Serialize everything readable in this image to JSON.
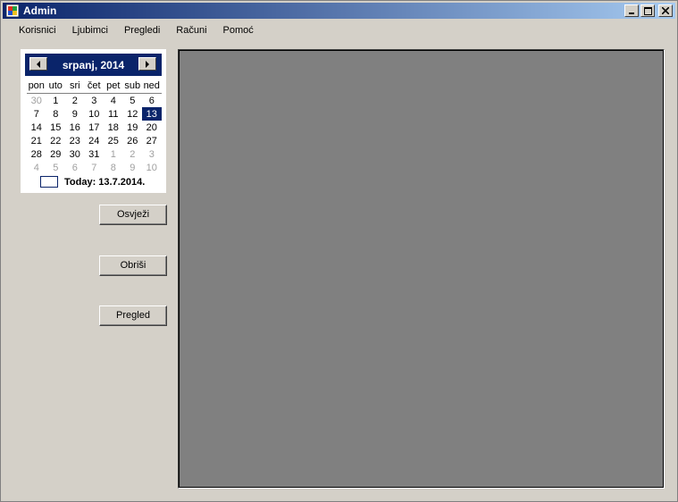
{
  "window": {
    "title": "Admin",
    "controls": {
      "minimize": "minimize-icon",
      "maximize": "maximize-icon",
      "close": "close-icon"
    }
  },
  "menu": {
    "items": [
      "Korisnici",
      "Ljubimci",
      "Pregledi",
      "Računi",
      "Pomoć"
    ]
  },
  "calendar": {
    "month_label": "srpanj, 2014",
    "day_names": [
      "pon",
      "uto",
      "sri",
      "čet",
      "pet",
      "sub",
      "ned"
    ],
    "weeks": [
      [
        "30",
        "1",
        "2",
        "3",
        "4",
        "5",
        "6"
      ],
      [
        "7",
        "8",
        "9",
        "10",
        "11",
        "12",
        "13"
      ],
      [
        "14",
        "15",
        "16",
        "17",
        "18",
        "19",
        "20"
      ],
      [
        "21",
        "22",
        "23",
        "24",
        "25",
        "26",
        "27"
      ],
      [
        "28",
        "29",
        "30",
        "31",
        "1",
        "2",
        "3"
      ],
      [
        "4",
        "5",
        "6",
        "7",
        "8",
        "9",
        "10"
      ]
    ],
    "selected_day": "13",
    "today_label": "Today: 13.7.2014."
  },
  "buttons": {
    "refresh": "Osvježi",
    "delete": "Obriši",
    "view": "Pregled"
  },
  "colors": {
    "window_bg": "#d4d0c8",
    "title_gradient_start": "#0a246a",
    "title_gradient_end": "#a6caf0",
    "panel_bg": "#808080",
    "selection": "#0a246a"
  }
}
